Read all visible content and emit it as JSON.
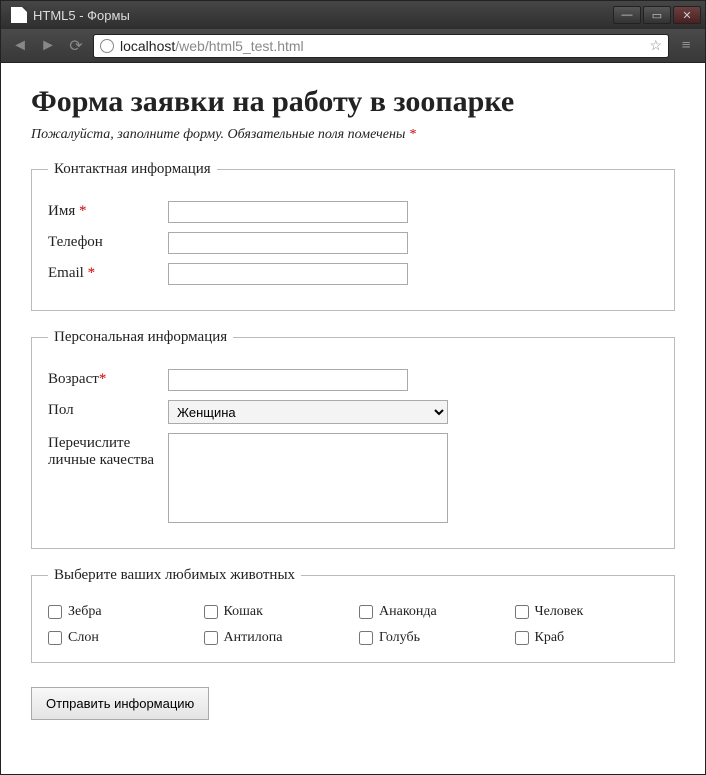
{
  "window": {
    "title": "HTML5 - Формы"
  },
  "browser": {
    "url_host": "localhost",
    "url_path": "/web/html5_test.html"
  },
  "page": {
    "heading": "Форма заявки на работу в зоопарке",
    "subtitle_prefix": "Пожалуйста, заполните форму. Обязательные поля помечены ",
    "required_marker": "*"
  },
  "fieldsets": {
    "contact": {
      "legend": "Контактная информация",
      "fields": {
        "name": {
          "label": "Имя ",
          "required": true,
          "value": ""
        },
        "phone": {
          "label": "Телефон",
          "required": false,
          "value": ""
        },
        "email": {
          "label": "Email ",
          "required": true,
          "value": ""
        }
      }
    },
    "personal": {
      "legend": "Персональная информация",
      "fields": {
        "age": {
          "label": "Возраст",
          "required": true,
          "value": ""
        },
        "gender": {
          "label": "Пол",
          "selected": "Женщина"
        },
        "traits": {
          "label": "Перечислите личные качества",
          "value": ""
        }
      }
    },
    "animals": {
      "legend": "Выберите ваших любимых животных",
      "items": [
        "Зебра",
        "Кошак",
        "Анаконда",
        "Человек",
        "Слон",
        "Антилопа",
        "Голубь",
        "Краб"
      ]
    }
  },
  "submit_label": "Отправить информацию"
}
